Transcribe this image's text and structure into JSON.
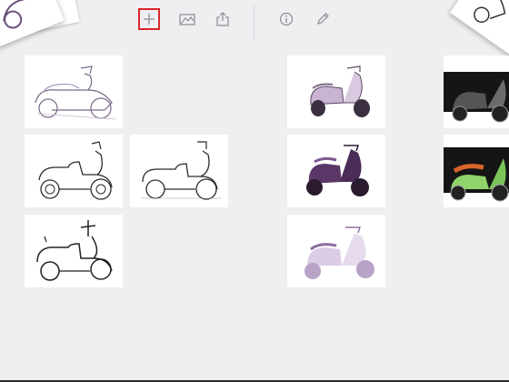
{
  "toolbar": {
    "buttons": [
      {
        "icon": "plus-icon",
        "selected": true
      },
      {
        "icon": "gallery-icon",
        "selected": false
      },
      {
        "icon": "share-icon",
        "selected": false
      },
      {
        "icon": "info-icon",
        "selected": false
      },
      {
        "icon": "pencil-icon",
        "selected": false
      }
    ],
    "selected_outline_color": "#d9262c"
  },
  "colors": {
    "background": "#efeff2",
    "sketch_line": "#2b2b2b",
    "purple_light": "#c9b4d3",
    "purple_dark": "#5b3768",
    "green_accent": "#8fd36a",
    "orange_accent": "#d9642c"
  },
  "gallery": {
    "thumbnails": [
      {
        "id": "sketch-1",
        "style": "line-sketch-purple"
      },
      {
        "id": "sketch-2",
        "style": "line-sketch"
      },
      {
        "id": "sketch-3",
        "style": "line-sketch"
      },
      {
        "id": "sketch-4",
        "style": "line-sketch-dark"
      },
      {
        "id": "sketch-5",
        "style": "color-lavender"
      },
      {
        "id": "sketch-6",
        "style": "color-dark-purple"
      },
      {
        "id": "sketch-7",
        "style": "color-pale-lavender"
      },
      {
        "id": "sketch-8",
        "style": "color-dark"
      },
      {
        "id": "sketch-9",
        "style": "color-green"
      }
    ]
  }
}
